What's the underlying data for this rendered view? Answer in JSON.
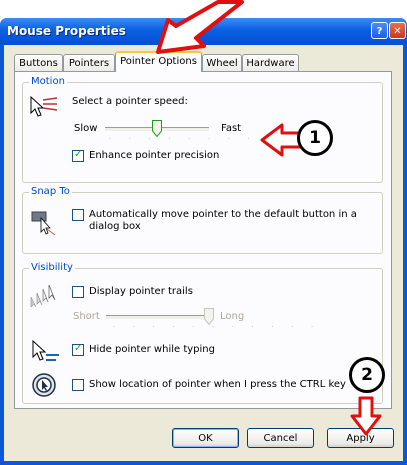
{
  "window": {
    "title": "Mouse Properties",
    "help_label": "?",
    "close_label": "✕"
  },
  "tabs": [
    {
      "label": "Buttons",
      "active": false
    },
    {
      "label": "Pointers",
      "active": false
    },
    {
      "label": "Pointer Options",
      "active": true
    },
    {
      "label": "Wheel",
      "active": false
    },
    {
      "label": "Hardware",
      "active": false
    }
  ],
  "motion": {
    "group_label": "Motion",
    "prompt": "Select a pointer speed:",
    "slow_label": "Slow",
    "fast_label": "Fast",
    "speed_level": 0.5,
    "enhance_label": "Enhance pointer precision",
    "enhance_checked": true
  },
  "snap_to": {
    "group_label": "Snap To",
    "auto_label_line1": "Automatically move pointer to the default button in a",
    "auto_label_line2": "dialog box",
    "auto_checked": false
  },
  "visibility": {
    "group_label": "Visibility",
    "trails_label": "Display pointer trails",
    "trails_checked": false,
    "short_label": "Short",
    "long_label": "Long",
    "trail_level": 1.0,
    "hide_label": "Hide pointer while typing",
    "hide_checked": true,
    "ctrl_label": "Show location of pointer when I press the CTRL key",
    "ctrl_checked": false
  },
  "buttons": {
    "ok_label": "OK",
    "cancel_label": "Cancel",
    "apply_label": "Apply"
  },
  "annotations": {
    "callout_1": "1",
    "callout_2": "2",
    "arrow_color": "#FF0000"
  }
}
